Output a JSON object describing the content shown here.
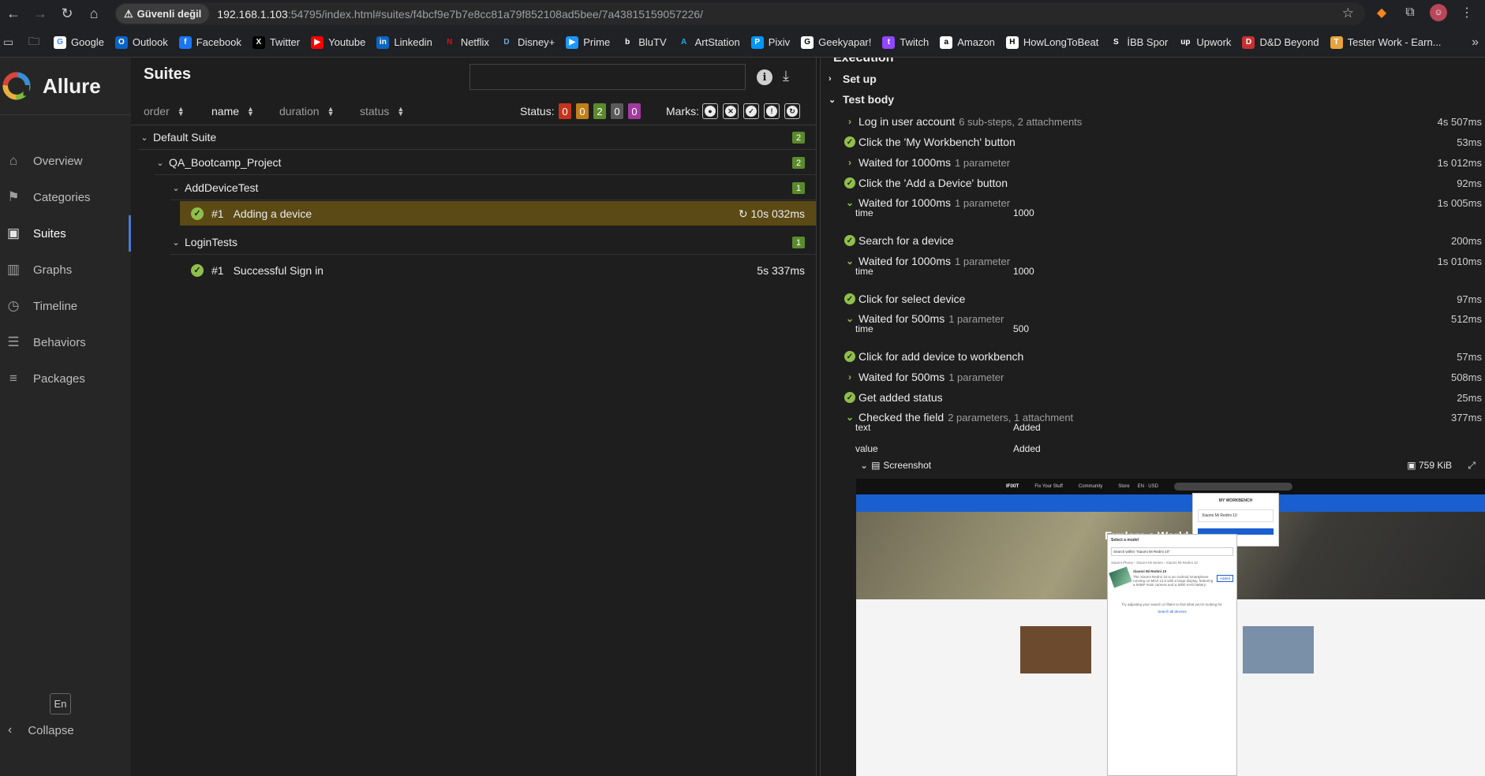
{
  "browser": {
    "security_label": "Güvenli değil",
    "url_host": "192.168.1.103",
    "url_rest": ":54795/index.html#suites/f4bcf9e7b7e8cc81a79f852108ad5bee/7a43815159057226/",
    "bookmarks": [
      {
        "label": "Google",
        "color": "#ffffff",
        "glyph": "G",
        "fg": "#4285f4"
      },
      {
        "label": "Outlook",
        "color": "#0a64c8",
        "glyph": "O",
        "fg": "#ffffff"
      },
      {
        "label": "Facebook",
        "color": "#1877f2",
        "glyph": "f",
        "fg": "#ffffff"
      },
      {
        "label": "Twitter",
        "color": "#000000",
        "glyph": "X",
        "fg": "#ffffff"
      },
      {
        "label": "Youtube",
        "color": "#ff0000",
        "glyph": "▶",
        "fg": "#ffffff"
      },
      {
        "label": "Linkedin",
        "color": "#0a66c2",
        "glyph": "in",
        "fg": "#ffffff"
      },
      {
        "label": "Netflix",
        "color": "#202124",
        "glyph": "N",
        "fg": "#e50914"
      },
      {
        "label": "Disney+",
        "color": "#202124",
        "glyph": "D",
        "fg": "#6fa8dc"
      },
      {
        "label": "Prime",
        "color": "#1a98ff",
        "glyph": "▶",
        "fg": "#ffffff"
      },
      {
        "label": "BluTV",
        "color": "#202124",
        "glyph": "b",
        "fg": "#ffffff"
      },
      {
        "label": "ArtStation",
        "color": "#202124",
        "glyph": "A",
        "fg": "#13aff0"
      },
      {
        "label": "Pixiv",
        "color": "#0096fa",
        "glyph": "P",
        "fg": "#ffffff"
      },
      {
        "label": "Geekyapar!",
        "color": "#ffffff",
        "glyph": "G",
        "fg": "#000000"
      },
      {
        "label": "Twitch",
        "color": "#9146ff",
        "glyph": "t",
        "fg": "#ffffff"
      },
      {
        "label": "Amazon",
        "color": "#ffffff",
        "glyph": "a",
        "fg": "#000000"
      },
      {
        "label": "HowLongToBeat",
        "color": "#ffffff",
        "glyph": "H",
        "fg": "#000000"
      },
      {
        "label": "İBB Spor",
        "color": "#202124",
        "glyph": "S",
        "fg": "#ffffff"
      },
      {
        "label": "Upwork",
        "color": "#202124",
        "glyph": "up",
        "fg": "#ffffff"
      },
      {
        "label": "D&D Beyond",
        "color": "#c53131",
        "glyph": "D",
        "fg": "#ffffff"
      },
      {
        "label": "Tester Work - Earn...",
        "color": "#e8a33d",
        "glyph": "T",
        "fg": "#ffffff"
      }
    ]
  },
  "sidebar": {
    "brand": "Allure",
    "items": [
      {
        "label": "Overview",
        "icon": "home-icon"
      },
      {
        "label": "Categories",
        "icon": "flag-icon"
      },
      {
        "label": "Suites",
        "icon": "briefcase-icon"
      },
      {
        "label": "Graphs",
        "icon": "bar-chart-icon"
      },
      {
        "label": "Timeline",
        "icon": "clock-icon"
      },
      {
        "label": "Behaviors",
        "icon": "list-icon"
      },
      {
        "label": "Packages",
        "icon": "align-left-icon"
      }
    ],
    "active": "Suites",
    "language": "En",
    "collapse_label": "Collapse"
  },
  "suites": {
    "title": "Suites",
    "search_placeholder": "",
    "sort": {
      "order": "order",
      "name": "name",
      "duration": "duration",
      "status": "status"
    },
    "status_label": "Status:",
    "status_counts": [
      {
        "value": "0",
        "color": "#c5341c"
      },
      {
        "value": "0",
        "color": "#c08019"
      },
      {
        "value": "2",
        "color": "#5b8a2d"
      },
      {
        "value": "0",
        "color": "#5a5a5a"
      },
      {
        "value": "0",
        "color": "#a23aa0"
      }
    ],
    "marks_label": "Marks:",
    "tree": {
      "default_suite": {
        "label": "Default Suite",
        "count": "2"
      },
      "project": {
        "label": "QA_Bootcamp_Project",
        "count": "2"
      },
      "add_device": {
        "label": "AddDeviceTest",
        "count": "1",
        "test_num": "#1",
        "test_name": "Adding a device",
        "test_duration": "10s 032ms"
      },
      "login": {
        "label": "LoginTests",
        "count": "1",
        "test_num": "#1",
        "test_name": "Successful Sign in",
        "test_duration": "5s 337ms"
      }
    }
  },
  "execution": {
    "title": "Execution",
    "setup_label": "Set up",
    "body_label": "Test body",
    "steps": [
      {
        "label": "Log in user account",
        "sub": "6 sub-steps, 2 attachments",
        "dur": "4s 507ms",
        "kind": "chev-right"
      },
      {
        "label": "Click the 'My Workbench' button",
        "sub": "",
        "dur": "53ms",
        "kind": "ok"
      },
      {
        "label": "Waited for 1000ms",
        "sub": "1 parameter",
        "dur": "1s 012ms",
        "kind": "chev-right"
      },
      {
        "label": "Click the 'Add a Device' button",
        "sub": "",
        "dur": "92ms",
        "kind": "ok"
      },
      {
        "label": "Waited for 1000ms",
        "sub": "1 parameter",
        "dur": "1s 005ms",
        "kind": "chev-down"
      },
      {
        "label": "Search for a device",
        "sub": "",
        "dur": "200ms",
        "kind": "ok"
      },
      {
        "label": "Waited for 1000ms",
        "sub": "1 parameter",
        "dur": "1s 010ms",
        "kind": "chev-down"
      },
      {
        "label": "Click for select device",
        "sub": "",
        "dur": "97ms",
        "kind": "ok"
      },
      {
        "label": "Waited for 500ms",
        "sub": "1 parameter",
        "dur": "512ms",
        "kind": "chev-down"
      },
      {
        "label": "Click for add device to workbench",
        "sub": "",
        "dur": "57ms",
        "kind": "ok"
      },
      {
        "label": "Waited for 500ms",
        "sub": "1 parameter",
        "dur": "508ms",
        "kind": "chev-right"
      },
      {
        "label": "Get added status",
        "sub": "",
        "dur": "25ms",
        "kind": "ok"
      },
      {
        "label": "Checked the field",
        "sub": "2 parameters, 1 attachment",
        "dur": "377ms",
        "kind": "chev-down"
      }
    ],
    "params": {
      "p1": {
        "name": "time",
        "value": "1000"
      },
      "p2": {
        "name": "time",
        "value": "1000"
      },
      "p3": {
        "name": "time",
        "value": "500"
      },
      "p4": {
        "name": "text",
        "value": "Added"
      },
      "p5": {
        "name": "value",
        "value": "Added"
      }
    },
    "attachment": {
      "name": "Screenshot",
      "size": "759 KiB"
    }
  },
  "screenshot": {
    "logo": "IFIXIT",
    "nav": [
      "Fix Your Stuff",
      "Community",
      "Store",
      "EN · USD"
    ],
    "banner_title": "Explore a World of",
    "workbench_title": "MY WORKBENCH",
    "workbench_item": "Xiaomi Mi Redmi 10",
    "modal_title": "Select a model",
    "modal_search": "Search within \"Xiaomi Mi Redmi 10\"",
    "breadcrumb": "Xiaomi Phone › Xiaomi Mi Series › Xiaomi Mi Redmi 10",
    "device_name": "Xiaomi Mi Redmi 10",
    "device_desc": "The Xiaomi Redmi 10 is an Android smartphone running on MIUI 12.5 with a large display, featuring a 50MP main camera and a 5000 mAh battery.",
    "added": "Added",
    "footer_text": "Try adjusting your search or filters to find what you're looking for.",
    "footer_link": "Search all devices"
  }
}
